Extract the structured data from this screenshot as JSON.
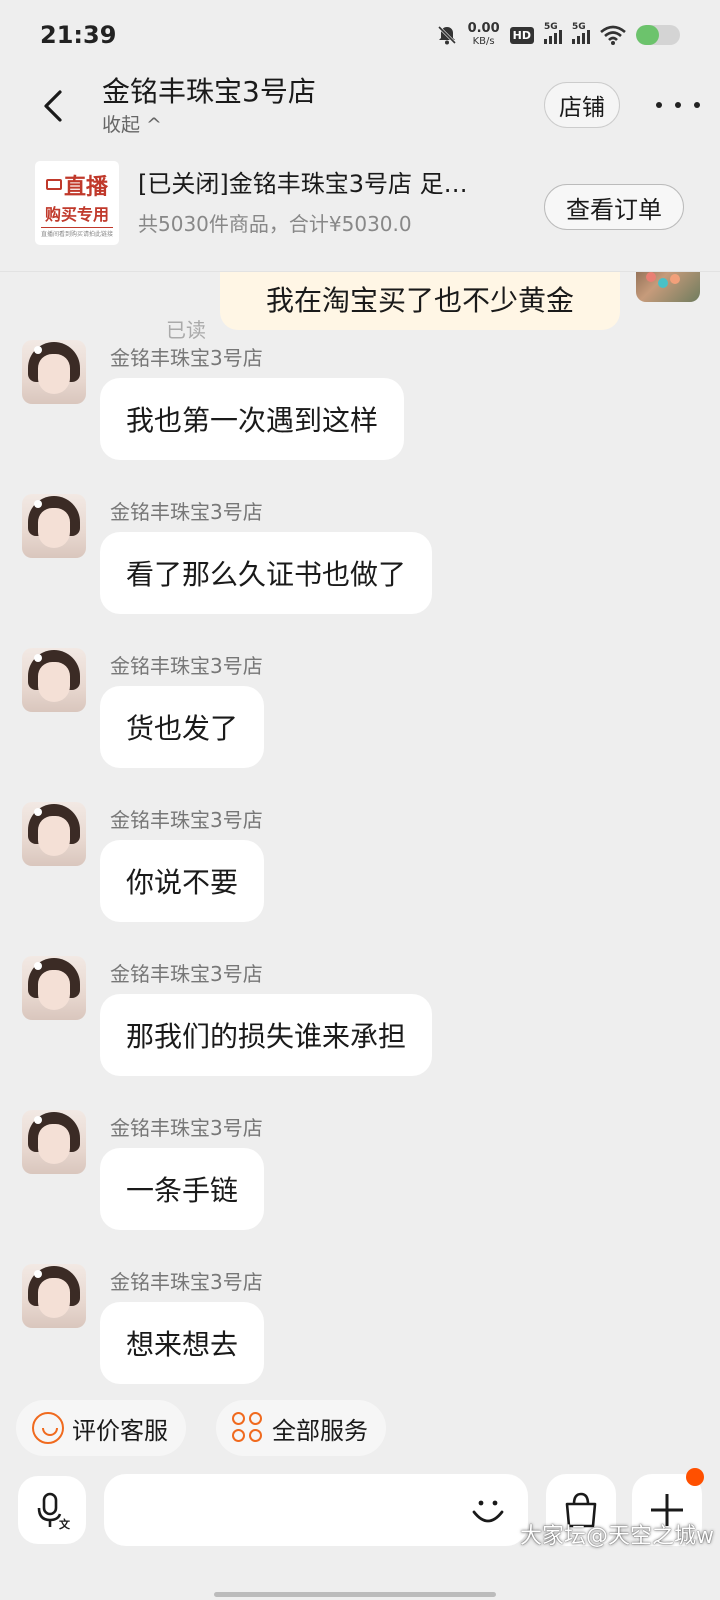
{
  "status_bar": {
    "time": "21:39",
    "net_speed_value": "0.00",
    "net_speed_unit": "KB/s",
    "hd_label": "HD",
    "sim1_label": "5G",
    "sim2_label": "5G"
  },
  "header": {
    "shop_name": "金铭丰珠宝3号店",
    "collapse_label": "收起 ^",
    "shop_button": "店铺"
  },
  "order_card": {
    "thumb_line1": "直播",
    "thumb_line2": "购买专用",
    "thumb_line3": "直播间看到购买请拍此链接",
    "title": "[已关闭]金铭丰珠宝3号店 足…",
    "subtitle": "共5030件商品，合计¥5030.0",
    "view_order_button": "查看订单"
  },
  "sent_message": {
    "text": "我在淘宝买了也不少黄金",
    "read_status": "已读"
  },
  "messages": [
    {
      "sender": "金铭丰珠宝3号店",
      "text": "我也第一次遇到这样"
    },
    {
      "sender": "金铭丰珠宝3号店",
      "text": "看了那么久证书也做了"
    },
    {
      "sender": "金铭丰珠宝3号店",
      "text": "货也发了"
    },
    {
      "sender": "金铭丰珠宝3号店",
      "text": "你说不要"
    },
    {
      "sender": "金铭丰珠宝3号店",
      "text": "那我们的损失谁来承担"
    },
    {
      "sender": "金铭丰珠宝3号店",
      "text": "一条手链"
    },
    {
      "sender": "金铭丰珠宝3号店",
      "text": "想来想去"
    }
  ],
  "quick_actions": {
    "rate_service": "评价客服",
    "all_services": "全部服务"
  },
  "input_bar": {
    "placeholder": "",
    "watermark": "大家坛@天空之城w"
  },
  "colors": {
    "accent": "#f06a1e",
    "sent_bubble": "#fff6e5",
    "background": "#eeeeee",
    "notification_dot": "#ff5000"
  }
}
